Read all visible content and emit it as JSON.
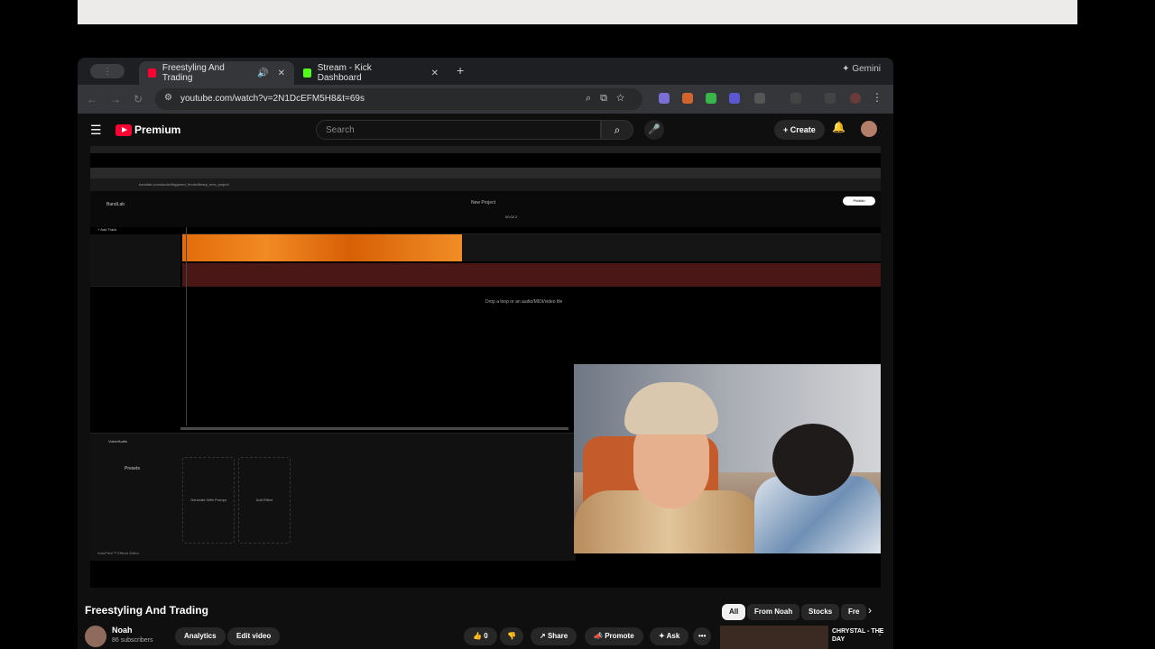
{
  "mac": {
    "apple_glyph": ""
  },
  "browser": {
    "tabs": [
      {
        "label": "Freestyling And Trading",
        "active": true
      },
      {
        "label": "Stream - Kick Dashboard",
        "active": false
      }
    ],
    "tab_group_label": "⋮ ",
    "new_tab": "+",
    "gemini": "✦ Gemini",
    "url": "youtube.com/watch?v=2N1DcEFM5H8&t=69s"
  },
  "youtube": {
    "logo_text": "Premium",
    "search_placeholder": "Search",
    "create_label": "Create",
    "video": {
      "bandlab_url": "bandlab.com/studio/triggered_fronts/library_new_project",
      "bandlab_brand": "BandLab",
      "project_title": "New Project",
      "time_display": "00:02.2",
      "publish_label": "Publish",
      "add_track_label": "+ Add Track",
      "drop_hint": "Drop a loop or an audio/MIDI/video file",
      "effects_title": "Voice/Audio",
      "presets_label": "Presets",
      "effect_cards": [
        "Generate With Prompt",
        "Add Effect"
      ],
      "bottom_tabs": "AutoPitch™   Effects   Editor"
    },
    "title": "Freestyling And Trading",
    "channel": {
      "name": "Noah",
      "subs": "86 subscribers"
    },
    "buttons": {
      "analytics": "Analytics",
      "edit_video": "Edit video",
      "likes": "0",
      "share": "Share",
      "promote": "Promote",
      "ask": "Ask",
      "more": "•••"
    },
    "chips": [
      "All",
      "From Noah",
      "Stocks",
      "Fre"
    ],
    "side_video": {
      "title": "CHRYSTAL - THE DAY"
    }
  },
  "colors": {
    "brand_red": "#ff0033",
    "bg": "#0f0f0f",
    "waveform_orange": "#f28a23"
  }
}
